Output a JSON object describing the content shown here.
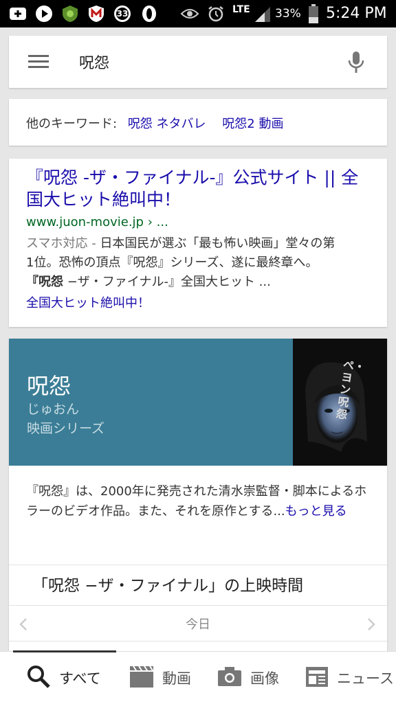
{
  "status_bar": {
    "notification_count": "33",
    "network": "LTE",
    "battery": "33%",
    "time": "5:24 PM"
  },
  "search": {
    "query": "呪怨"
  },
  "related": {
    "label": "他のキーワード:",
    "items": [
      "呪怨 ネタバレ",
      "呪怨2 動画"
    ]
  },
  "result": {
    "title": "『呪怨 -ザ・ファイナル-』公式サイト || 全国大ヒット絶叫中！",
    "url": "www.juon-movie.jp › ...",
    "mobile_tag": "スマホ対応",
    "snippet_line1": "日本国民が選ぶ「最も怖い映画」堂々の第",
    "snippet_line2": "1位。恐怖の頂点『呪怨』シリーズ、遂に最終章へ。",
    "snippet_line3_bold": "『呪怨",
    "snippet_line3_rest": " −ザ・ファイナル-』全国大ヒット ...",
    "sitelink": "全国大ヒット絶叫中！"
  },
  "knowledge": {
    "title": "呪怨",
    "reading": "じゅおん",
    "category": "映画シリーズ",
    "poster_text": "ペ・ヨン呪怨",
    "description": "『呪怨』は、2000年に発売された清水崇監督・脚本によるホラーのビデオ作品。また、それを原作とする...",
    "more_link": "もっと見る",
    "showtimes_title": "「呪怨 −ザ・ファイナル」の上映時間",
    "day_label": "今日"
  },
  "bottom_nav": {
    "all": "すべて",
    "videos": "動画",
    "images": "画像",
    "news": "ニュース"
  }
}
